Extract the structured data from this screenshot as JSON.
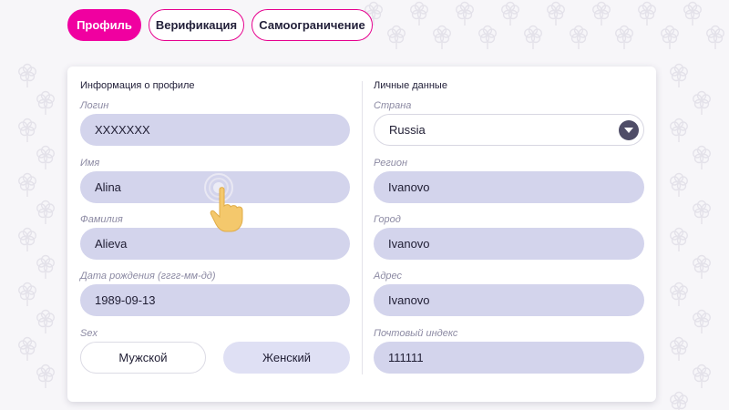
{
  "tabs": [
    {
      "label": "Профиль",
      "active": true
    },
    {
      "label": "Верификация",
      "active": false
    },
    {
      "label": "Самоограничение",
      "active": false
    }
  ],
  "profile_info": {
    "title": "Информация о профиле",
    "login": {
      "label": "Логин",
      "value": "XXXXXXX"
    },
    "first_name": {
      "label": "Имя",
      "value": "Alina"
    },
    "last_name": {
      "label": "Фамилия",
      "value": "Alieva"
    },
    "birth_date": {
      "label": "Дата рождения (гггг-мм-дд)",
      "value": "1989-09-13"
    },
    "sex": {
      "label": "Sex",
      "male": "Мужской",
      "female": "Женский"
    }
  },
  "personal_data": {
    "title": "Личные данные",
    "country": {
      "label": "Страна",
      "value": "Russia"
    },
    "region": {
      "label": "Регион",
      "value": "Ivanovo"
    },
    "city": {
      "label": "Город",
      "value": "Ivanovo"
    },
    "address": {
      "label": "Адрес",
      "value": "Ivanovo"
    },
    "postal_code": {
      "label": "Почтовый индекс",
      "value": "111111"
    }
  },
  "colors": {
    "accent": "#f000a0",
    "field_bg": "#d3d4ec",
    "text": "#23213a",
    "label": "#8c8aa3"
  },
  "icons": {
    "dropdown": "chevron-down-icon",
    "cursor": "tap-hand-icon",
    "background": "flower-pattern"
  }
}
